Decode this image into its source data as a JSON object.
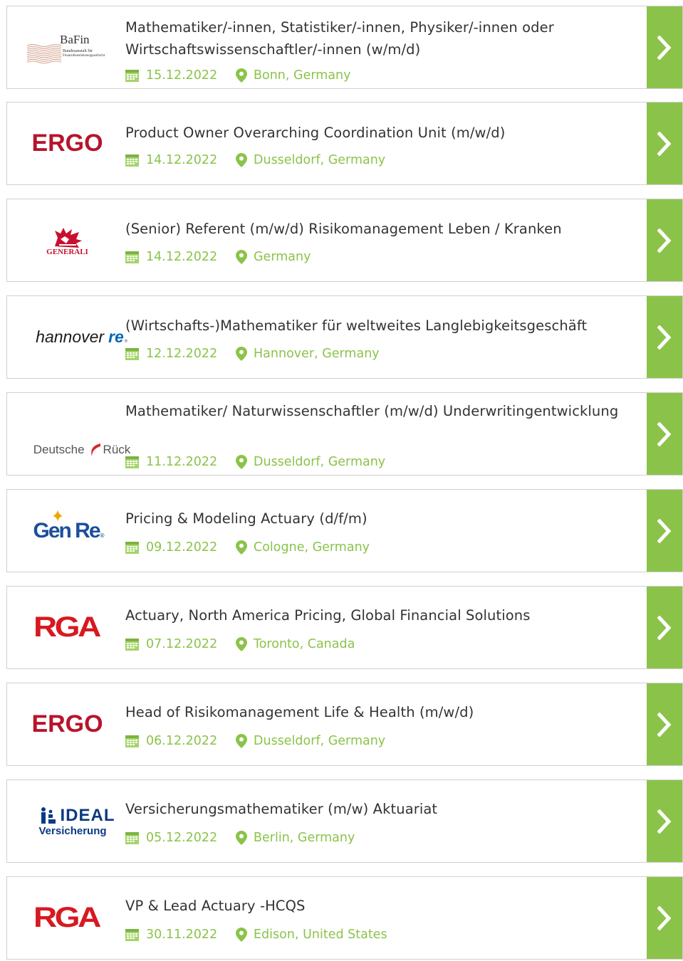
{
  "jobs": [
    {
      "title": "Mathematiker/-innen, Statistiker/-innen, Physiker/-innen oder Wirtschaftswissenschaftler/-innen (w/m/d)",
      "date": "15.12.2022",
      "location": "Bonn, Germany",
      "logo": {
        "type": "bafin",
        "name": "BaFin",
        "subtitle_line1": "Bundesanstalt für",
        "subtitle_line2": "Finanzdienstleistungsaufsicht"
      }
    },
    {
      "title": "Product Owner Overarching Coordination Unit (m/w/d)",
      "date": "14.12.2022",
      "location": "Dusseldorf, Germany",
      "logo": {
        "type": "ergo",
        "name": "ERGO"
      }
    },
    {
      "title": "(Senior) Referent (m/w/d) Risikomanagement Leben / Kranken",
      "date": "14.12.2022",
      "location": "Germany",
      "logo": {
        "type": "generali",
        "name": "GENERALI"
      }
    },
    {
      "title": "(Wirtschafts-)Mathematiker für weltweites Langlebigkeitsgeschäft",
      "date": "12.12.2022",
      "location": "Hannover, Germany",
      "logo": {
        "type": "hannover",
        "name": "hannover",
        "accent": "re"
      }
    },
    {
      "title": "Mathematiker/ Naturwissenschaftler (m/w/d) Underwritingentwicklung",
      "date": "11.12.2022",
      "location": "Dusseldorf, Germany",
      "logo": {
        "type": "deutsche",
        "name": "Deutsche",
        "accent": "Rück"
      }
    },
    {
      "title": "Pricing & Modeling Actuary (d/f/m)",
      "date": "09.12.2022",
      "location": "Cologne, Germany",
      "logo": {
        "type": "genre",
        "name": "Gen Re"
      }
    },
    {
      "title": "Actuary, North America Pricing, Global Financial Solutions",
      "date": "07.12.2022",
      "location": "Toronto, Canada",
      "logo": {
        "type": "rga",
        "name": "RGA"
      }
    },
    {
      "title": "Head of Risikomanagement Life & Health (m/w/d)",
      "date": "06.12.2022",
      "location": "Dusseldorf, Germany",
      "logo": {
        "type": "ergo",
        "name": "ERGO"
      }
    },
    {
      "title": "Versicherungsmathematiker (m/w) Aktuariat",
      "date": "05.12.2022",
      "location": "Berlin, Germany",
      "logo": {
        "type": "ideal",
        "name": "IDEAL",
        "subtitle": "Versicherung"
      }
    },
    {
      "title": "VP & Lead Actuary -HCQS",
      "date": "30.11.2022",
      "location": "Edison, United States",
      "logo": {
        "type": "rga",
        "name": "RGA"
      }
    }
  ],
  "colors": {
    "accent_green": "#8bc34a",
    "title_text": "#333333",
    "border": "#d0d0d0"
  },
  "icons": {
    "date": "calendar-icon",
    "location": "map-pin-icon",
    "open": "chevron-right-icon"
  }
}
